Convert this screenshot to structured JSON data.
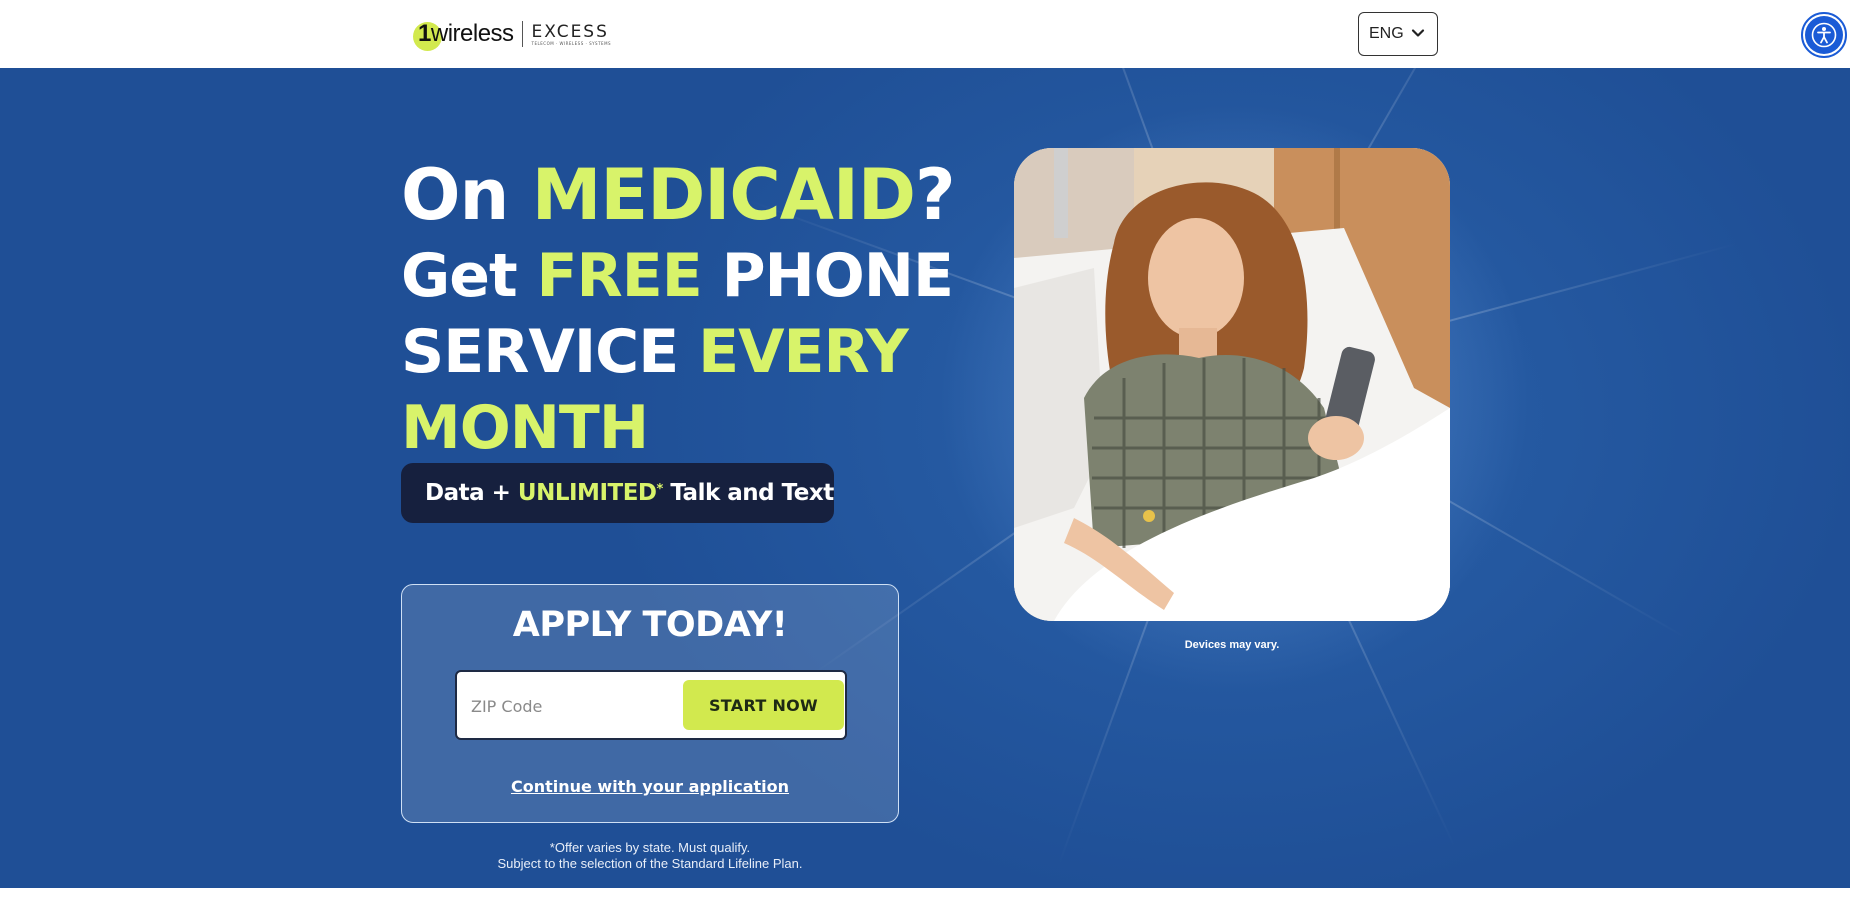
{
  "header": {
    "logo_primary_num": "1",
    "logo_primary_text": "wireless",
    "logo_secondary_text": "EXCESS",
    "logo_secondary_tagline": "TELECOM · WIRELESS · SYSTEMS",
    "language_selected": "ENG",
    "accessibility_icon": "accessibility-icon"
  },
  "hero": {
    "headline_line1_a": "On ",
    "headline_line1_b": "MEDICAID",
    "headline_line1_c": "?",
    "headline_line2_a": "Get ",
    "headline_line2_b": "FREE",
    "headline_line2_c": " PHONE",
    "headline_line3_a": "SERVICE ",
    "headline_line3_b": "EVERY",
    "headline_line4": "MONTH",
    "pill_a": "Data + ",
    "pill_b": "UNLIMITED",
    "pill_star": "*",
    "pill_c": " Talk and Text"
  },
  "apply": {
    "title": "APPLY TODAY!",
    "zip_placeholder": "ZIP Code",
    "start_button": "START NOW",
    "continue_link": "Continue with your application"
  },
  "disclaimer": {
    "line1": "*Offer varies by state. Must qualify.",
    "line2": "Subject to the selection of the Standard Lifeline Plan."
  },
  "image": {
    "caption": "Devices may vary."
  },
  "colors": {
    "hero_bg": "#1f4f96",
    "lime_accent": "#d8f36a",
    "button_bg": "#d2e94e",
    "pill_bg": "#16203e",
    "a11y_blue": "#1a5bd6"
  }
}
